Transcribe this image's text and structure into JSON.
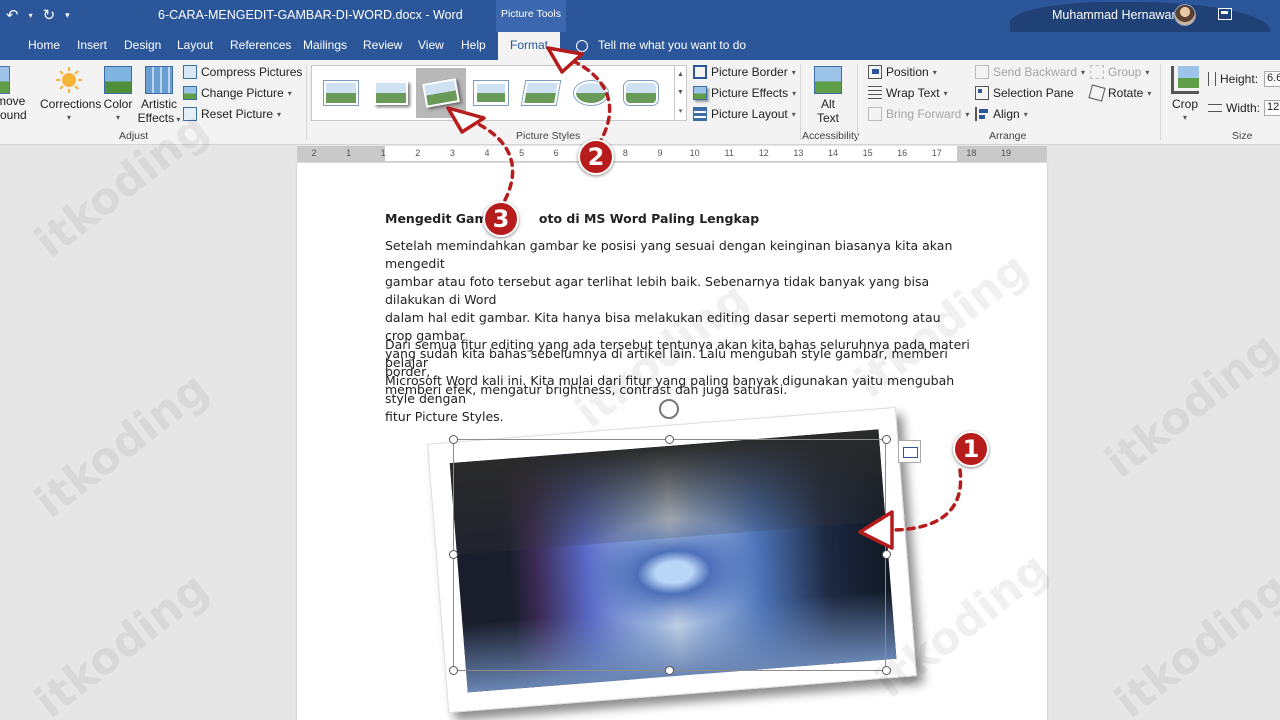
{
  "titlebar": {
    "doc_title": "6-CARA-MENGEDIT-GAMBAR-DI-WORD.docx - Word",
    "context_tools": "Picture Tools",
    "user": "Muhammad Hernawan"
  },
  "tabs": [
    "Home",
    "Insert",
    "Design",
    "Layout",
    "References",
    "Mailings",
    "Review",
    "View",
    "Help",
    "Format"
  ],
  "tell_me": "Tell me what you want to do",
  "ribbon": {
    "adjust": {
      "remove_bg_top": "move",
      "remove_bg_bottom": "round",
      "corrections": "Corrections",
      "color": "Color",
      "artistic_1": "Artistic",
      "artistic_2": "Effects",
      "compress": "Compress Pictures",
      "change": "Change Picture",
      "reset": "Reset Picture",
      "label": "Adjust"
    },
    "styles": {
      "border": "Picture Border",
      "effects": "Picture Effects",
      "layout": "Picture Layout",
      "label": "Picture Styles"
    },
    "accessibility": {
      "alt_1": "Alt",
      "alt_2": "Text",
      "label": "Accessibility"
    },
    "arrange": {
      "position": "Position",
      "wrap": "Wrap Text",
      "bring": "Bring Forward",
      "send": "Send Backward",
      "selection": "Selection Pane",
      "align": "Align",
      "group": "Group",
      "rotate": "Rotate",
      "label": "Arrange"
    },
    "size": {
      "crop": "Crop",
      "height": "Height:",
      "height_value": "6.6",
      "width": "Width:",
      "width_value": "12.",
      "label": "Size"
    }
  },
  "ruler": [
    "2",
    "1",
    "1",
    "2",
    "3",
    "4",
    "5",
    "6",
    "7",
    "8",
    "9",
    "10",
    "11",
    "12",
    "13",
    "14",
    "15",
    "16",
    "17",
    "18",
    "19"
  ],
  "document": {
    "heading_a": "Mengedit Gamba",
    "heading_b": "oto di MS Word Paling Lengkap",
    "p1": [
      "Setelah memindahkan gambar ke posisi yang sesuai dengan keinginan biasanya kita akan mengedit",
      "gambar atau foto tersebut agar terlihat lebih baik. Sebenarnya tidak banyak yang bisa dilakukan di Word",
      "dalam hal edit gambar. Kita hanya bisa melakukan editing dasar seperti memotong atau crop gambar",
      "yang sudah kita bahas sebelumnya di artikel lain. Lalu mengubah style gambar, memberi border,",
      "memberi efek, mengatur brightness, contrast dan juga saturasi."
    ],
    "p2": [
      "Dari semua fitur editing yang ada tersebut tentunya akan kita bahas seluruhnya pada materi belajar",
      "Microsoft Word kali ini. Kita mulai dari fitur yang paling banyak digunakan yaitu mengubah style dengan",
      "fitur Picture Styles."
    ]
  },
  "annotations": {
    "step1": "1",
    "step2": "2",
    "step3": "3",
    "color": "#b71c1c"
  },
  "watermark": "itkoding",
  "colors": {
    "word_blue": "#2b579a",
    "ribbon_bg": "#f3f3f3"
  }
}
